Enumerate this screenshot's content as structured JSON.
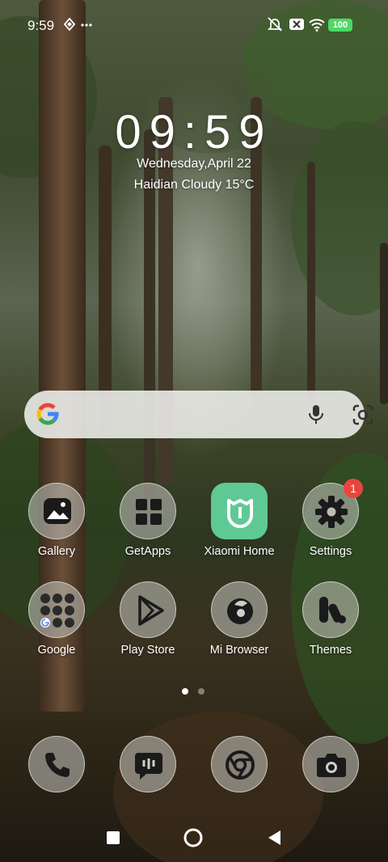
{
  "status_bar": {
    "time": "9:59",
    "icons": [
      "nfc-icon",
      "more-dots-icon",
      "mute-icon",
      "close-box-icon",
      "wifi-icon"
    ],
    "battery": "100"
  },
  "clock": {
    "time": "09:59",
    "date": "Wednesday,April 22",
    "weather": "Haidian Cloudy 15°C"
  },
  "search_bar": {
    "icons": [
      "google-logo-icon",
      "microphone-icon",
      "google-lens-icon"
    ]
  },
  "apps": [
    {
      "label": "Gallery",
      "icon": "gallery-icon"
    },
    {
      "label": "GetApps",
      "icon": "getapps-icon"
    },
    {
      "label": "Xiaomi Home",
      "icon": "xiaomi-home-icon"
    },
    {
      "label": "Settings",
      "icon": "gear-icon",
      "badge": "1"
    },
    {
      "label": "Google",
      "icon": "google-folder-icon"
    },
    {
      "label": "Play Store",
      "icon": "play-store-icon"
    },
    {
      "label": "Mi Browser",
      "icon": "mi-browser-icon"
    },
    {
      "label": "Themes",
      "icon": "themes-icon"
    }
  ],
  "page_indicator": {
    "pages": 2,
    "current": 1
  },
  "dock": [
    {
      "icon": "phone-icon"
    },
    {
      "icon": "messages-icon"
    },
    {
      "icon": "chrome-icon"
    },
    {
      "icon": "camera-icon"
    }
  ],
  "nav_bar": {
    "icons": [
      "recents-square-icon",
      "home-circle-icon",
      "back-triangle-icon"
    ]
  },
  "colors": {
    "badge": "#e8463c",
    "battery": "#4cd964",
    "xiaomi_home": "#5fc996"
  }
}
